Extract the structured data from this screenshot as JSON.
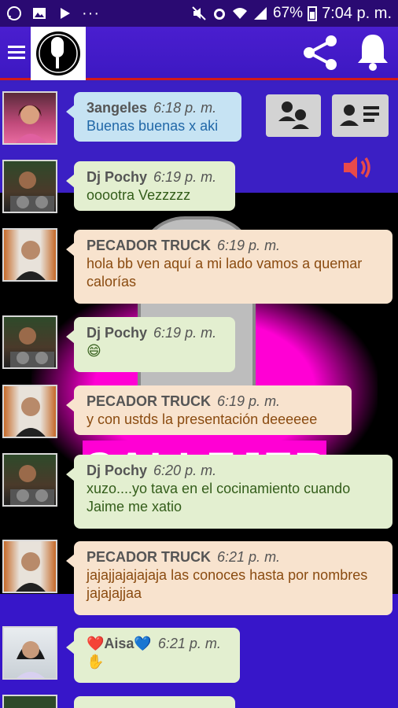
{
  "status_bar": {
    "battery": "67%",
    "time": "7:04 p. m."
  },
  "app_bar": {
    "icons": [
      "menu-icon",
      "logo",
      "share-icon",
      "bell-icon"
    ]
  },
  "messages": [
    {
      "user": "3angeles",
      "time": "6:18 p. m.",
      "text": "Buenas buenas x aki",
      "style": "blue"
    },
    {
      "user": "Dj Pochy",
      "time": "6:19 p. m.",
      "text": "ooootra Vezzzzz",
      "style": "green"
    },
    {
      "user": "PECADOR TRUCK",
      "time": "6:19 p. m.",
      "text": "hola bb ven aquí a mi lado vamos a quemar calorías",
      "style": "peach"
    },
    {
      "user": "Dj Pochy",
      "time": "6:19 p. m.",
      "text": "😄",
      "style": "green"
    },
    {
      "user": "PECADOR TRUCK",
      "time": "6:19 p. m.",
      "text": "y con ustds la presentación deeeeee",
      "style": "peach"
    },
    {
      "user": "Dj Pochy",
      "time": "6:20 p. m.",
      "text": "xuzo....yo tava en el cocinamiento cuando Jaime me xatio",
      "style": "green"
    },
    {
      "user": "PECADOR TRUCK",
      "time": "6:21 p. m.",
      "text": "jajajjajajajaja las conoces hasta por nombres jajajajjaa",
      "style": "peach"
    },
    {
      "user": "❤️Aisa💙",
      "time": "6:21 p. m.",
      "text": "✋",
      "style": "green"
    }
  ],
  "background": {
    "banner": "CALLEJEROS"
  }
}
